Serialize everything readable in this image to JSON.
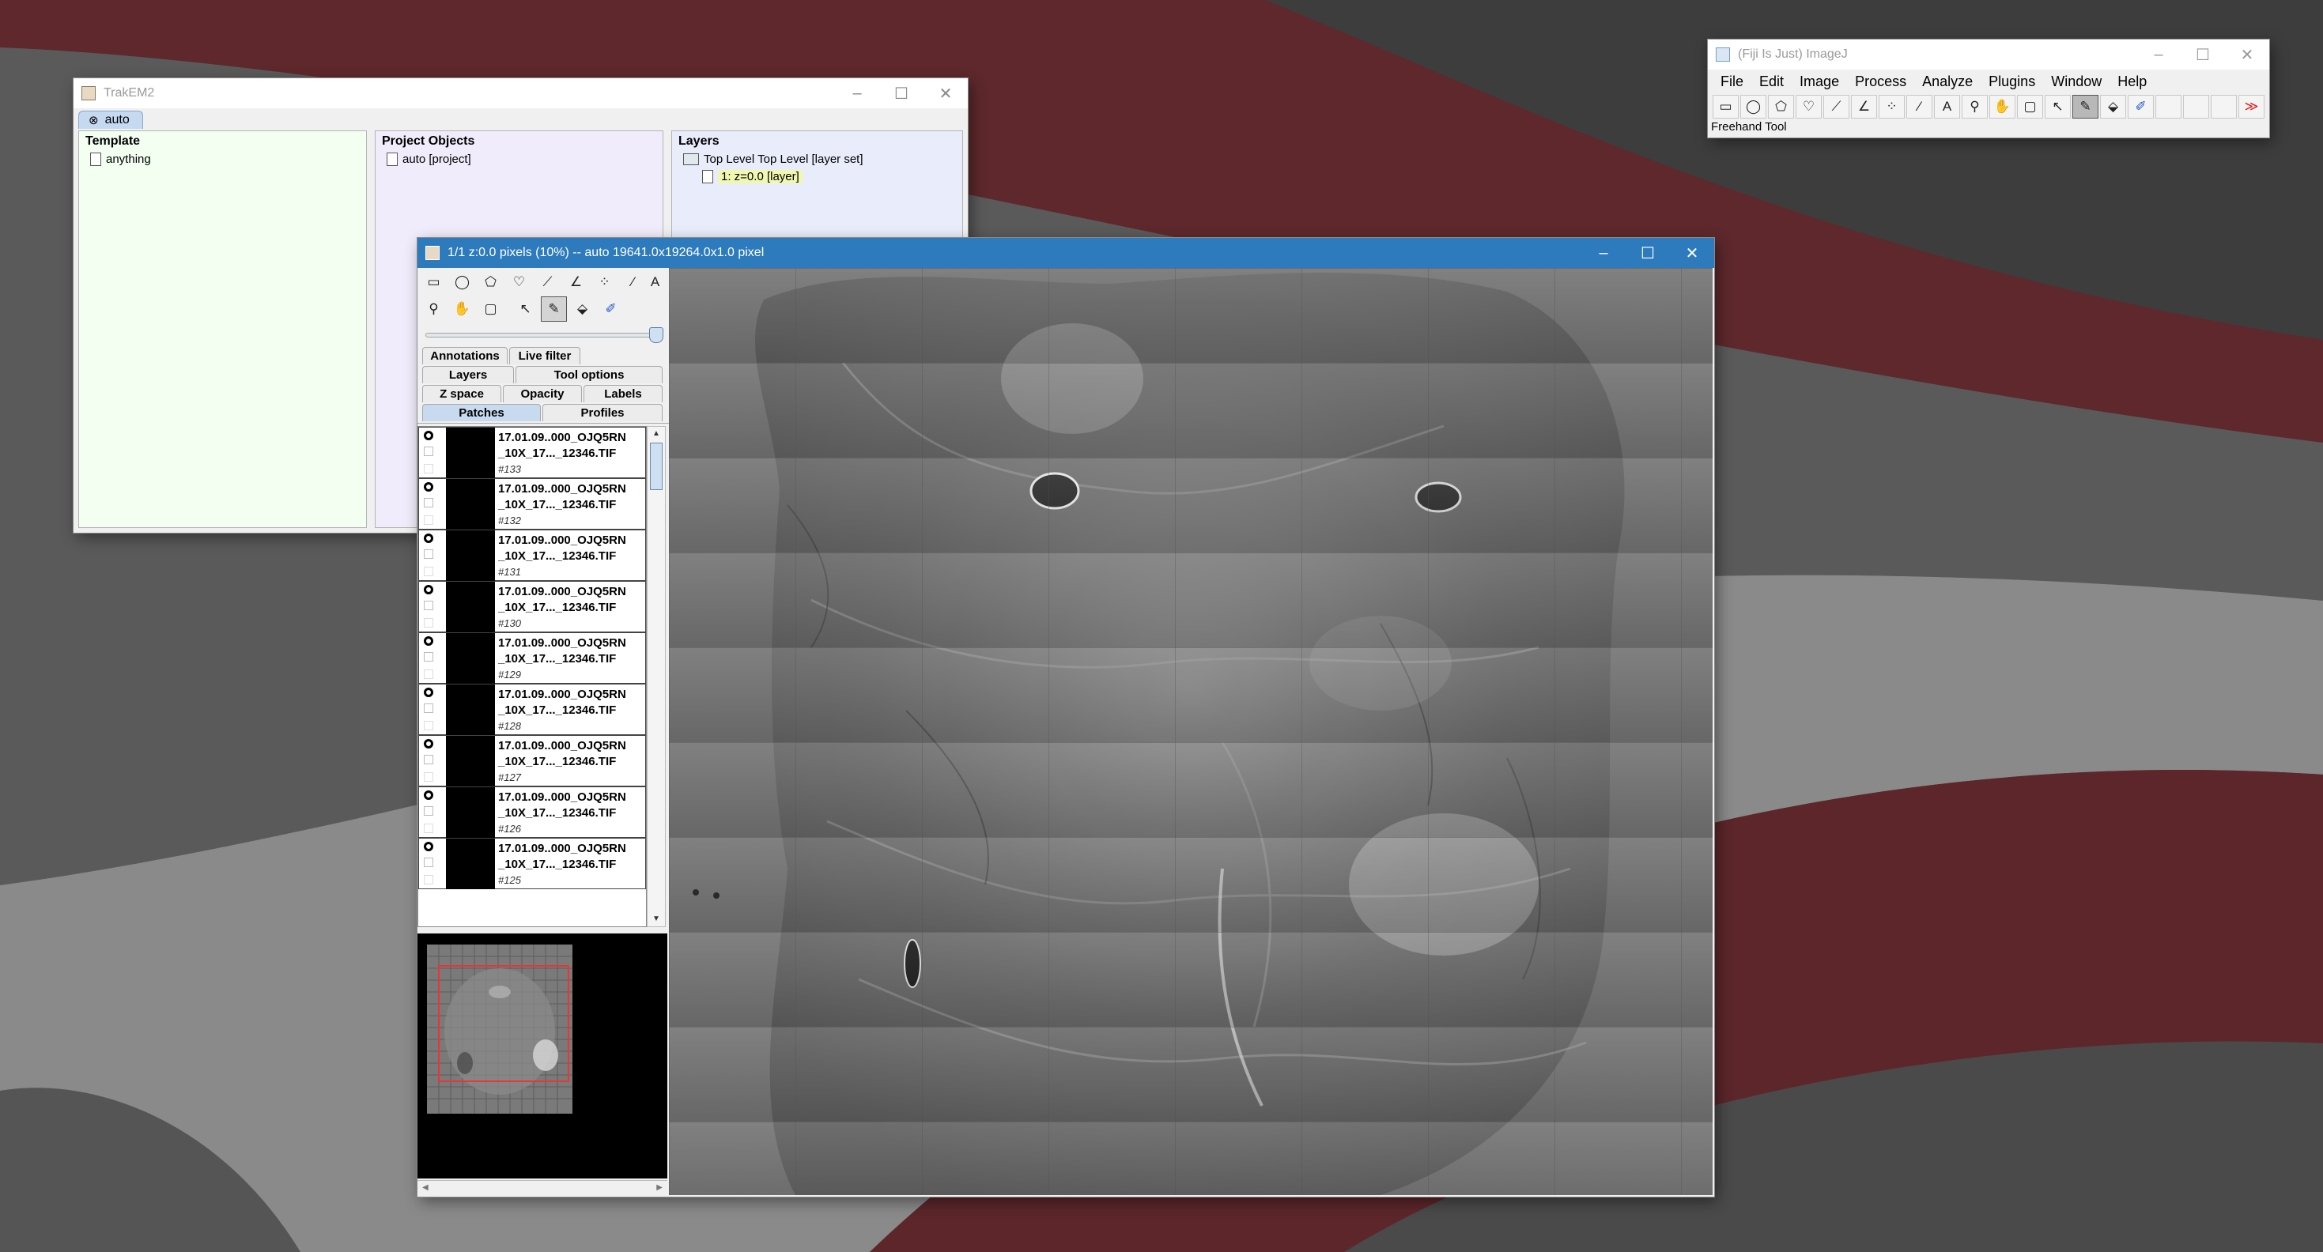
{
  "fiji": {
    "title": "(Fiji Is Just) ImageJ",
    "menus": [
      "File",
      "Edit",
      "Image",
      "Process",
      "Analyze",
      "Plugins",
      "Window",
      "Help"
    ],
    "status": "Freehand Tool",
    "tools": [
      {
        "name": "rectangle-tool",
        "glyph": "▭"
      },
      {
        "name": "oval-tool",
        "glyph": "◯"
      },
      {
        "name": "polygon-tool",
        "glyph": "⬠"
      },
      {
        "name": "freehand-selection-tool",
        "glyph": "♡"
      },
      {
        "name": "line-tool",
        "glyph": "⟋"
      },
      {
        "name": "angle-tool",
        "glyph": "∠"
      },
      {
        "name": "multipoint-tool",
        "glyph": "⁘"
      },
      {
        "name": "wand-tool",
        "glyph": "⁄"
      },
      {
        "name": "text-tool",
        "glyph": "A"
      },
      {
        "name": "magnifier-tool",
        "glyph": "⚲"
      },
      {
        "name": "hand-tool",
        "glyph": "✋"
      },
      {
        "name": "dropper-tool",
        "glyph": "▢"
      },
      {
        "name": "arrow-tool",
        "glyph": "↖"
      },
      {
        "name": "brush-tool",
        "glyph": "✎"
      },
      {
        "name": "fill-tool",
        "glyph": "⬙"
      },
      {
        "name": "pen-tool",
        "glyph": "✐"
      },
      {
        "name": "empty-slot-1",
        "glyph": ""
      },
      {
        "name": "empty-slot-2",
        "glyph": ""
      },
      {
        "name": "empty-slot-3",
        "glyph": ""
      },
      {
        "name": "more-tools",
        "glyph": "≫"
      }
    ]
  },
  "trakem": {
    "title": "TrakEM2",
    "tab": "auto",
    "template": {
      "title": "Template",
      "item": "anything"
    },
    "project_objects": {
      "title": "Project Objects",
      "item": "auto [project]"
    },
    "layers": {
      "title": "Layers",
      "root": "Top Level Top Level [layer set]",
      "child": "1:  z=0.0 [layer]"
    },
    "colors": {
      "template": "#f3fff1",
      "objects": "#f1ecfb",
      "layers": "#e9ecfb",
      "layer_highlight": "#f0f7b0"
    }
  },
  "display": {
    "title": "1/1  z:0.0 pixels  (10%) -- auto  19641.0x19264.0x1.0 pixel",
    "tabs_row1": [
      "Annotations",
      "Live filter"
    ],
    "tabs_row2": [
      "Layers",
      "Tool options"
    ],
    "tabs_row3": [
      "Z space",
      "Opacity",
      "Labels"
    ],
    "tabs_row4": [
      "Patches",
      "Profiles"
    ],
    "patches": [
      {
        "line1": "17.01.09..000_OJQ5RN",
        "line2": "_10X_17..._12346.TIF",
        "id": "#133"
      },
      {
        "line1": "17.01.09..000_OJQ5RN",
        "line2": "_10X_17..._12346.TIF",
        "id": "#132"
      },
      {
        "line1": "17.01.09..000_OJQ5RN",
        "line2": "_10X_17..._12346.TIF",
        "id": "#131"
      },
      {
        "line1": "17.01.09..000_OJQ5RN",
        "line2": "_10X_17..._12346.TIF",
        "id": "#130"
      },
      {
        "line1": "17.01.09..000_OJQ5RN",
        "line2": "_10X_17..._12346.TIF",
        "id": "#129"
      },
      {
        "line1": "17.01.09..000_OJQ5RN",
        "line2": "_10X_17..._12346.TIF",
        "id": "#128"
      },
      {
        "line1": "17.01.09..000_OJQ5RN",
        "line2": "_10X_17..._12346.TIF",
        "id": "#127"
      },
      {
        "line1": "17.01.09..000_OJQ5RN",
        "line2": "_10X_17..._12346.TIF",
        "id": "#126"
      },
      {
        "line1": "17.01.09..000_OJQ5RN",
        "line2": "_10X_17..._12346.TIF",
        "id": "#125"
      }
    ],
    "accent_color": "#2d7bbd"
  }
}
